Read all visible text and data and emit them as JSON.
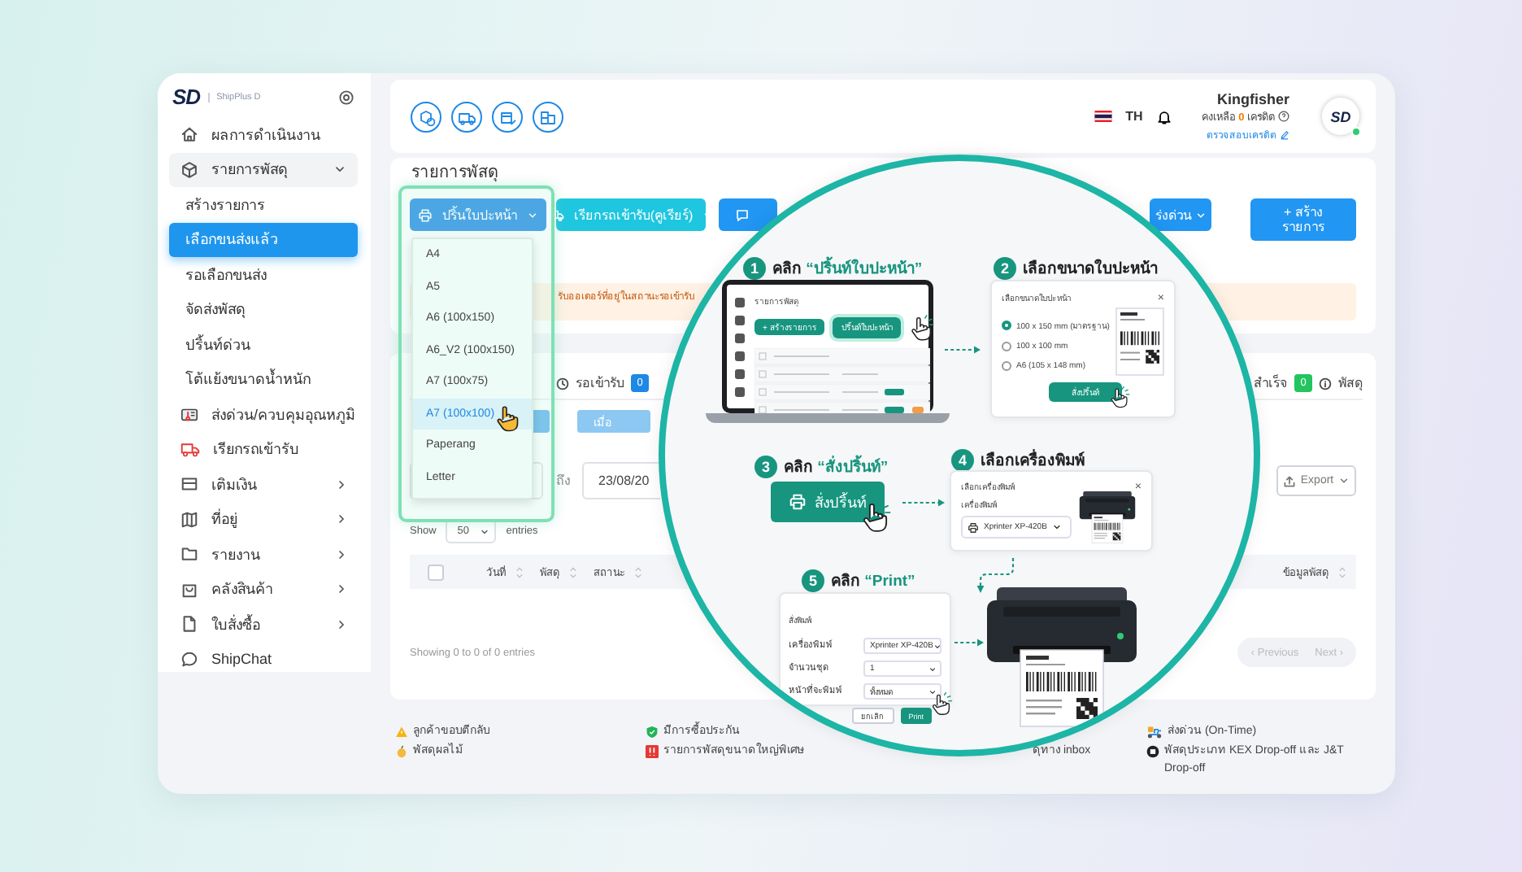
{
  "sidebar": {
    "logo": "SD",
    "product": "ShipPlus D",
    "items": [
      {
        "label": "ผลการดำเนินงาน",
        "kind": "link"
      },
      {
        "label": "รายการพัสดุ",
        "kind": "group",
        "expanded": true,
        "children": [
          {
            "label": "สร้างรายการ",
            "selected": false
          },
          {
            "label": "เลือกขนส่งแล้ว",
            "selected": true
          },
          {
            "label": "รอเลือกขนส่ง",
            "selected": false
          },
          {
            "label": "จัดส่งพัสดุ",
            "selected": false
          },
          {
            "label": "ปริ้นท์ด่วน",
            "selected": false
          },
          {
            "label": "โต้แย้งขนาดน้ำหนัก",
            "selected": false
          }
        ]
      },
      {
        "label": "ส่งด่วน/ควบคุมอุณหภูมิ",
        "kind": "link"
      },
      {
        "label": "เรียกรถเข้ารับ",
        "kind": "link"
      },
      {
        "label": "เติมเงิน",
        "kind": "group",
        "expanded": false
      },
      {
        "label": "ที่อยู่",
        "kind": "group",
        "expanded": false
      },
      {
        "label": "รายงาน",
        "kind": "group",
        "expanded": false
      },
      {
        "label": "คลังสินค้า",
        "kind": "group",
        "expanded": false
      },
      {
        "label": "ใบสั่งซื้อ",
        "kind": "group",
        "expanded": false
      },
      {
        "label": "ShipChat",
        "kind": "link"
      }
    ]
  },
  "top_bar": {
    "language": "TH",
    "user": {
      "name": "Kingfisher",
      "credit_label": "คงเหลือ",
      "credit_amount": "0",
      "credit_unit": "เครดิต",
      "check_credit": "ตรวจสอบเครดิต"
    },
    "avatar": {
      "logo": "SD",
      "online": true
    }
  },
  "parcels": {
    "title": "รายการพัสดุ",
    "actions": [
      {
        "kind": "print",
        "label": "ปริ้นใบปะหน้า"
      },
      {
        "kind": "pickup",
        "label": "เรียกรถเข้ารับ(คูเรียร์)"
      },
      {
        "kind": "chat"
      },
      {
        "kind": "urgent",
        "label": "ร่งด่วน"
      },
      {
        "kind": "create",
        "label": "+ สร้างรายการ"
      }
    ],
    "print_menu": [
      {
        "label": "A4",
        "selected": false
      },
      {
        "label": "A5",
        "selected": false
      },
      {
        "label": "A6 (100x150)",
        "selected": false
      },
      {
        "label": "A6_V2 (100x150)",
        "selected": false
      },
      {
        "label": "A7 (100x75)",
        "selected": false
      },
      {
        "label": "A7 (100x100)",
        "selected": true
      },
      {
        "label": "Paperang",
        "selected": false
      },
      {
        "label": "Letter",
        "selected": false
      }
    ],
    "notice": "รับออเดอร์ที่อยู่ในสถานะรอเข้ารับ"
  },
  "list": {
    "tabs": [
      {
        "kind": "waiting",
        "label": "รอเข้ารับ",
        "count": "0"
      },
      {
        "kind": "success",
        "label": "สำเร็จ",
        "count": "0"
      },
      {
        "kind": "info",
        "label": "พัสดุ"
      }
    ],
    "filter_button": "เมื่อ",
    "date_to_label": "ถึง",
    "date_to": "23/08/20",
    "export": "Export",
    "page_size": {
      "prefix": "Show",
      "value": "50",
      "suffix": "entries"
    },
    "columns": [
      "วันที่",
      "พัสดุ",
      "สถานะ",
      "ข้อมูลพัสดุ"
    ],
    "info": "Showing 0 to 0 of 0 entries",
    "select_all_checked": false,
    "pagination": [
      {
        "label": "‹ Previous",
        "disabled": true
      },
      {
        "label": "Next ›",
        "disabled": true
      }
    ]
  },
  "legend": [
    [
      {
        "kind": "warning",
        "label": "ลูกค้าขอบตีกลับ"
      },
      {
        "kind": "fruit",
        "label": "พัสดุผลไม้"
      }
    ],
    [
      {
        "kind": "insured",
        "label": "มีการซื้อประกัน"
      },
      {
        "kind": "oversize",
        "label": "รายการพัสดุขนาดใหญ่พิเศษ"
      }
    ],
    [
      {
        "kind": "plain",
        "label": "ดุทาง inbox"
      }
    ],
    [
      {
        "kind": "ontime",
        "label": "ส่งด่วน (On-Time)"
      },
      {
        "kind": "dropoff",
        "label": "พัสดุประเภท KEX Drop-off และ J&T Drop-off"
      }
    ]
  ],
  "guide": {
    "steps": [
      {
        "number": "1",
        "action": "คลิก",
        "target": "“ปริ้นท์ใบปะหน้า”",
        "kind": "laptop",
        "screen": {
          "title": "รายการพัสดุ",
          "create_button": "+ สร้างรายการ",
          "print_button": "ปริ้นท์ใบปะหน้า"
        }
      },
      {
        "number": "2",
        "action": "เลือกขนาดใบปะหน้า",
        "kind": "size-dialog",
        "dialog": {
          "title": "เลือกขนาดใบปะหน้า",
          "close": "×",
          "options": [
            {
              "label": "100 x 150 mm (มาตรฐาน)",
              "selected": true
            },
            {
              "label": "100 x 100 mm",
              "selected": false
            },
            {
              "label": "A6 (105 x 148 mm)",
              "selected": false
            }
          ],
          "button": "สั่งปริ้นท์"
        }
      },
      {
        "number": "3",
        "action": "คลิก",
        "target": "“สั่งปริ้นท์”",
        "kind": "button",
        "button": "สั่งปริ้นท์"
      },
      {
        "number": "4",
        "action": "เลือกเครื่องพิมพ์",
        "kind": "printer-dialog",
        "dialog": {
          "title": "เลือกเครื่องพิมพ์",
          "close": "×",
          "field_label": "เครื่องพิมพ์",
          "value": "Xprinter XP-420B"
        }
      },
      {
        "number": "5",
        "action": "คลิก",
        "target": "“Print”",
        "kind": "print-dialog",
        "dialog": {
          "title": "สั่งพิมพ์",
          "fields": [
            {
              "label": "เครื่องพิมพ์",
              "value": "Xprinter XP-420B"
            },
            {
              "label": "จำนวนชุด",
              "value": "1"
            },
            {
              "label": "หน้าที่จะพิมพ์",
              "value": "ทั้งหมด"
            }
          ],
          "buttons": [
            {
              "kind": "secondary",
              "label": "ยกเลิก"
            },
            {
              "kind": "primary",
              "label": "Print"
            }
          ]
        }
      }
    ]
  }
}
